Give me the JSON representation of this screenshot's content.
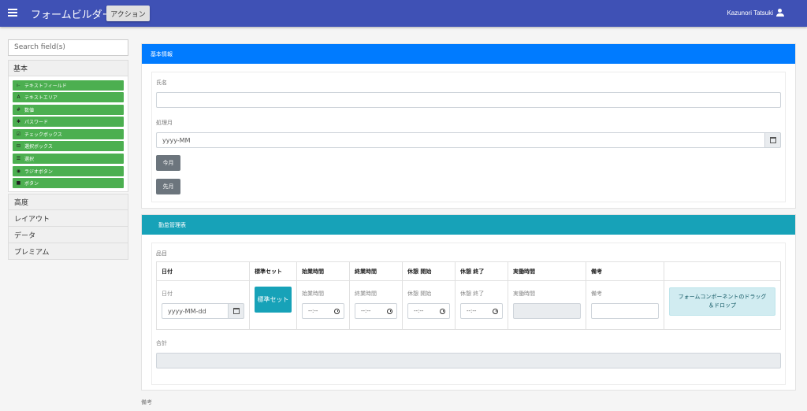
{
  "header": {
    "app_title": "フォームビルダー",
    "action_label": "アクション",
    "user_name": "Kazunori Tatsuki"
  },
  "sidebar": {
    "search_placeholder": "Search field(s)",
    "basic_label": "基本",
    "palette": [
      {
        "icon": "text-field-icon",
        "glyph": "ı₋",
        "label": "テキストフィールド"
      },
      {
        "icon": "text-area-icon",
        "glyph": "A",
        "label": "テキストエリア"
      },
      {
        "icon": "number-icon",
        "glyph": "#",
        "label": "数値"
      },
      {
        "icon": "asterisk-icon",
        "glyph": "✱",
        "label": "パスワード"
      },
      {
        "icon": "checkbox-icon",
        "glyph": "☑",
        "label": "チェックボックス"
      },
      {
        "icon": "select-box-icon",
        "glyph": "⊟",
        "label": "選択ボックス"
      },
      {
        "icon": "list-icon",
        "glyph": "☰",
        "label": "選択"
      },
      {
        "icon": "radio-icon",
        "glyph": "◉",
        "label": "ラジオボタン"
      },
      {
        "icon": "stop-icon",
        "glyph": "■",
        "label": "ボタン"
      }
    ],
    "categories": [
      "高度",
      "レイアウト",
      "データ",
      "プレミアム"
    ]
  },
  "basic_info": {
    "header": "基本情報",
    "name_label": "氏名",
    "month_label": "処理月",
    "month_placeholder": "yyyy-MM",
    "this_month_label": "今月",
    "last_month_label": "先月"
  },
  "attendance": {
    "header": "勤怠管理表",
    "items_label": "品目",
    "columns": [
      "日付",
      "標準セット",
      "始業時間",
      "終業時間",
      "休憩 開始",
      "休憩 終了",
      "実働時間",
      "備考",
      ""
    ],
    "row": {
      "date_label": "日付",
      "date_placeholder": "yyyy-MM-dd",
      "standard_set_button": "標準セット",
      "start_label": "始業時間",
      "end_label": "終業時間",
      "break_start_label": "休憩 開始",
      "break_end_label": "休憩 終了",
      "worked_label": "実働時間",
      "remarks_label": "備考",
      "time_placeholder": "--:--",
      "drop_zone_text": "フォームコンポーネントのドラッグ＆ドロップ"
    },
    "total_label": "合計"
  },
  "footer_remarks_label": "備考"
}
